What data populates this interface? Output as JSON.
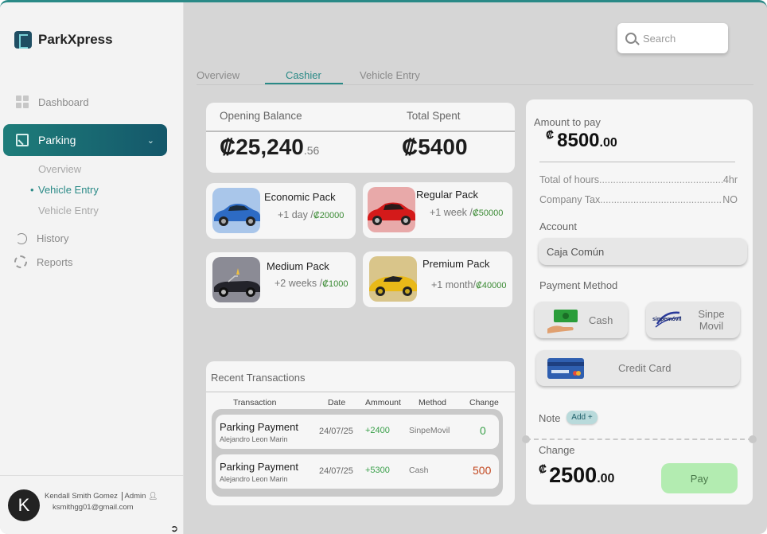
{
  "app": {
    "name": "ParkXpress"
  },
  "sidebar": {
    "items": [
      {
        "label": "Dashboard",
        "icon": "grid-icon"
      },
      {
        "label": "Parking",
        "icon": "parking-icon",
        "expanded": true
      },
      {
        "label": "History",
        "icon": "history-icon"
      },
      {
        "label": "Reports",
        "icon": "reports-icon"
      }
    ],
    "subitems": [
      {
        "label": "Overview",
        "active": false
      },
      {
        "label": "Vehicle Entry",
        "active": true
      },
      {
        "label": "Vehicle Entry",
        "active": false
      }
    ]
  },
  "user": {
    "initial": "K",
    "name": "Kendall Smith Gomez",
    "role": "Admin",
    "email": "ksmithgg01@gmail.com"
  },
  "search": {
    "placeholder": "Search"
  },
  "tabs": [
    {
      "label": "Overview",
      "active": false
    },
    {
      "label": "Cashier",
      "active": true
    },
    {
      "label": "Vehicle Entry",
      "active": false
    }
  ],
  "balance": {
    "opening_label": "Opening Balance",
    "opening_value": "₡25,240",
    "opening_decimal": ".56",
    "spent_label": "Total Spent",
    "spent_value": "₡5400"
  },
  "packs": [
    {
      "title": "Economic Pack",
      "duration": "+1 day /",
      "price": "₡20000",
      "color": "#a9c6ea"
    },
    {
      "title": "Regular Pack",
      "duration": "+1 week /",
      "price": "₡50000",
      "color": "#e8a9a9"
    },
    {
      "title": "Medium Pack",
      "duration": "+2 weeks /",
      "price": "₡1000",
      "color": "#8b8b95"
    },
    {
      "title": "Premium Pack",
      "duration": "+1 month/",
      "price": "₡40000",
      "color": "#d9c58a"
    }
  ],
  "transactions": {
    "title": "Recent Transactions",
    "headers": [
      "Transaction",
      "Date",
      "Ammount",
      "Method",
      "Change"
    ],
    "rows": [
      {
        "name": "Parking Payment",
        "customer": "Alejandro Leon Marin",
        "date": "24/07/25",
        "amount": "+2400",
        "method": "SinpeMovil",
        "change": "0"
      },
      {
        "name": "Parking Payment",
        "customer": "Alejandro Leon Marin",
        "date": "24/07/25",
        "amount": "+5300",
        "method": "Cash",
        "change": "500"
      }
    ]
  },
  "payment": {
    "amount_label": "Amount to pay",
    "currency": "₡",
    "amount": "8500",
    "amount_decimal": ".00",
    "hours_label": "Total of hours",
    "hours_value": "4hr",
    "tax_label": "Company Tax",
    "tax_value": "NO",
    "account_label": "Account",
    "account_value": "Caja Común",
    "method_label": "Payment Method",
    "methods": [
      {
        "label": "Cash",
        "icon": "cash-icon"
      },
      {
        "label": "Sinpe\nMovil",
        "icon": "sinpe-movil-logo"
      },
      {
        "label": "Credit Card",
        "icon": "credit-card-icon"
      }
    ],
    "sinpe_logo_text": "sinpemóvil",
    "note_label": "Note",
    "note_add": "Add +",
    "change_label": "Change",
    "change_value": "2500",
    "change_decimal": ".00",
    "pay_label": "Pay"
  },
  "colors": {
    "accent": "#2a8a87",
    "positive": "#3aa04a",
    "negative": "#c2471f",
    "pay_button": "#b3ecb1"
  }
}
